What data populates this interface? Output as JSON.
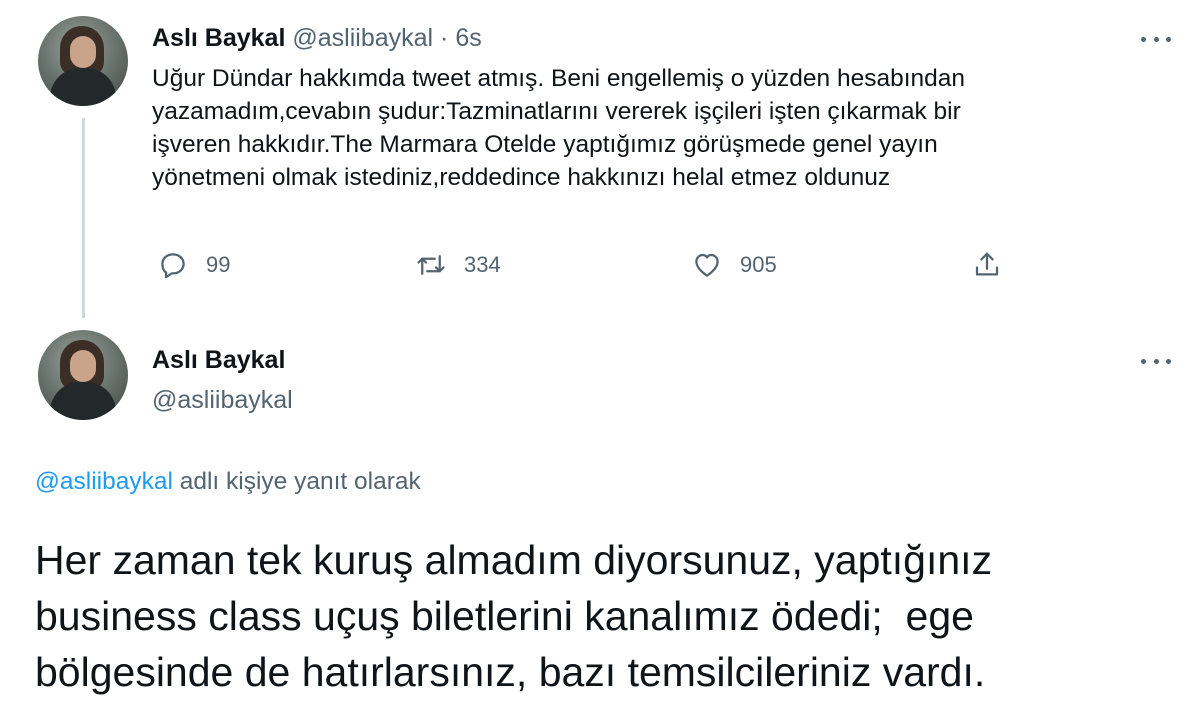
{
  "tweet1": {
    "name": "Aslı Baykal",
    "handle": "@asliibaykal",
    "separator": "·",
    "time": "6s",
    "lines": [
      "Uğur Dündar hakkımda tweet atmış. Beni engellemiş o yüzden hesabından",
      "yazamadım,cevabın şudur:Tazminatlarını vererek işçileri işten çıkarmak bir",
      "işveren hakkıdır.The Marmara Otelde yaptığımız görüşmede genel yayın",
      "yönetmeni olmak istediniz,reddedince hakkınızı helal etmez oldunuz"
    ],
    "replies": "99",
    "retweets": "334",
    "likes": "905"
  },
  "tweet2": {
    "name": "Aslı Baykal",
    "handle": "@asliibaykal",
    "reply_mention": "@asliibaykal",
    "reply_text": " adlı kişiye yanıt olarak",
    "lines": [
      "Her zaman tek kuruş almadım diyorsunuz, yaptığınız",
      "business class uçuş biletlerini kanalımız ödedi;  ege",
      "bölgesinde de hatırlarsınız, bazı temsilcileriniz vardı."
    ]
  },
  "icons": {
    "reply": "reply-icon",
    "retweet": "retweet-icon",
    "like": "heart-icon",
    "share": "share-icon",
    "more": "more-icon"
  },
  "colors": {
    "text": "#0f1419",
    "secondary": "#536471",
    "link": "#1d9bf0"
  }
}
